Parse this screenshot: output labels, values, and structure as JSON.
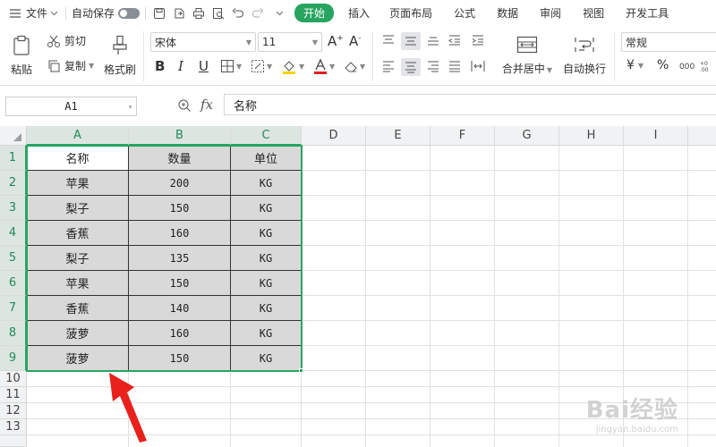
{
  "menubar": {
    "file_label": "文件",
    "autosave_label": "自动保存",
    "tabs": [
      "开始",
      "插入",
      "页面布局",
      "公式",
      "数据",
      "审阅",
      "视图",
      "开发工具"
    ],
    "active_tab": "开始"
  },
  "ribbon": {
    "paste_label": "粘贴",
    "cut_label": "剪切",
    "copy_label": "复制",
    "format_painter_label": "格式刷",
    "font_name": "宋体",
    "font_size": "11",
    "merge_center_label": "合并居中",
    "wrap_text_label": "自动换行",
    "number_format": "常规",
    "currency_symbol": "¥",
    "percent_symbol": "%"
  },
  "formula_bar": {
    "name_box": "A1",
    "fx_label": "fx",
    "content": "名称"
  },
  "grid": {
    "columns": [
      "A",
      "B",
      "C",
      "D",
      "E",
      "F",
      "G",
      "H",
      "I"
    ],
    "rows": [
      "1",
      "2",
      "3",
      "4",
      "5",
      "6",
      "7",
      "8",
      "9",
      "10",
      "11",
      "12",
      "13"
    ],
    "header": [
      "名称",
      "数量",
      "单位"
    ],
    "data": [
      [
        "苹果",
        "200",
        "KG"
      ],
      [
        "梨子",
        "150",
        "KG"
      ],
      [
        "香蕉",
        "160",
        "KG"
      ],
      [
        "梨子",
        "135",
        "KG"
      ],
      [
        "苹果",
        "150",
        "KG"
      ],
      [
        "香蕉",
        "140",
        "KG"
      ],
      [
        "菠萝",
        "160",
        "KG"
      ],
      [
        "菠萝",
        "150",
        "KG"
      ]
    ]
  },
  "colors": {
    "accent": "#27a560",
    "font_color_red": "#e02020",
    "highlight_yellow": "#f5d400",
    "arrow_red": "#e8211c",
    "filled_cell": "#d9d9d9"
  },
  "watermark": {
    "text": "Bai经验",
    "sub": "jingyan.baidu.com"
  }
}
